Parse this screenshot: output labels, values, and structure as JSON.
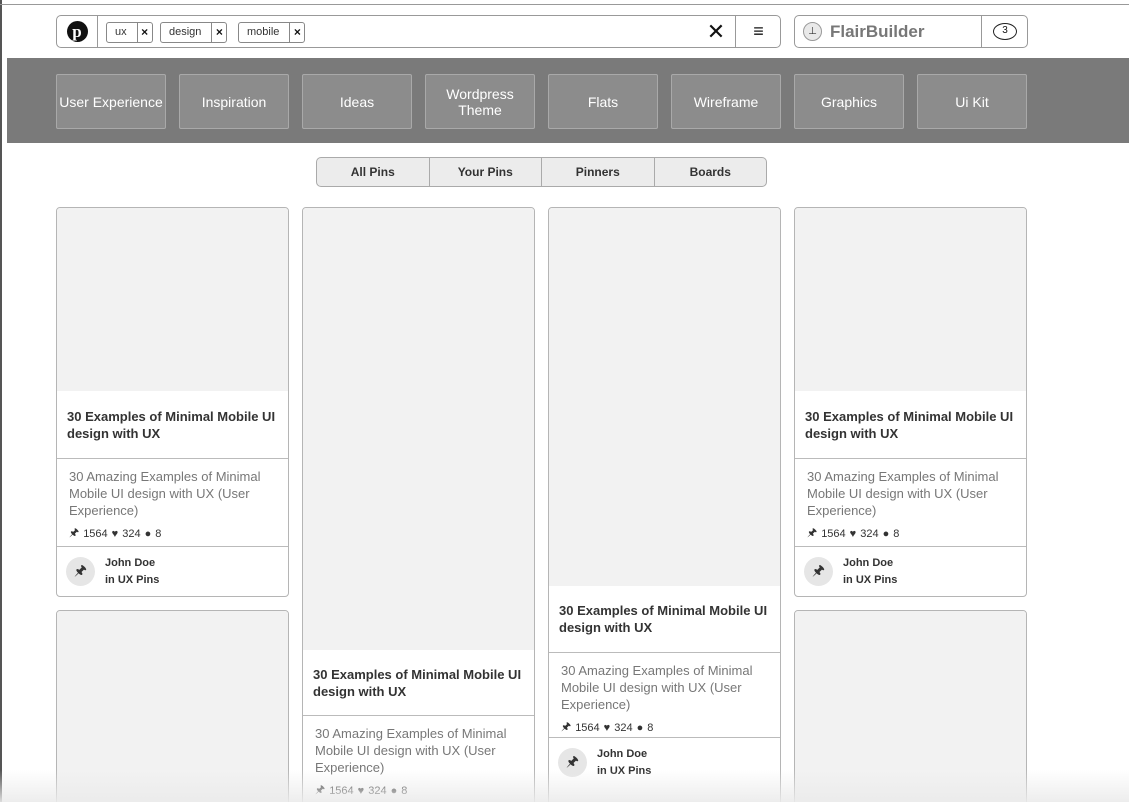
{
  "search": {
    "tags": [
      {
        "label": "ux",
        "remove": "×"
      },
      {
        "label": "design",
        "remove": "×"
      },
      {
        "label": "mobile",
        "remove": "×"
      }
    ],
    "clear_symbol": "✕",
    "menu_symbol": "≡",
    "logo_glyph": "p"
  },
  "brand": {
    "name": "FlairBuilder",
    "pin_glyph": "⊥",
    "notification_count": "3"
  },
  "categories": [
    "User Experience",
    "Inspiration",
    "Ideas",
    "Wordpress Theme",
    "Flats",
    "Wireframe",
    "Graphics",
    "Ui Kit"
  ],
  "filters": [
    "All Pins",
    "Your Pins",
    "Pinners",
    "Boards"
  ],
  "cards": [
    {
      "title": "30 Examples of  Minimal Mobile UI design with UX",
      "description": "30 Amazing Examples of Minimal Mobile UI design with UX (User Experience)",
      "repins": "1564",
      "likes": "324",
      "comments": "8",
      "author": "John Doe",
      "board": "in UX Pins"
    },
    {
      "title": "30 Examples of  Minimal Mobile UI design with UX",
      "description": "30 Amazing Examples of Minimal Mobile UI design with UX (User Experience)",
      "repins": "1564",
      "likes": "324",
      "comments": "8"
    },
    {
      "title": "30 Examples of  Minimal Mobile UI design with UX",
      "description": "30 Amazing Examples of Minimal Mobile UI design with UX (User Experience)",
      "repins": "1564",
      "likes": "324",
      "comments": "8",
      "author": "John Doe",
      "board": "in UX Pins"
    },
    {
      "title": "30 Examples of  Minimal Mobile UI design with UX",
      "description": "30 Amazing Examples of Minimal Mobile UI design with UX (User Experience)",
      "repins": "1564",
      "likes": "324",
      "comments": "8",
      "author": "John Doe",
      "board": "in UX Pins"
    }
  ],
  "icons": {
    "pin": "pin-icon",
    "heart": "heart-icon",
    "comment": "comment-icon"
  },
  "colors": {
    "category_bar": "#7a7a7a",
    "category_button": "#8c8c8c",
    "thumb": "#f2f2f2"
  }
}
